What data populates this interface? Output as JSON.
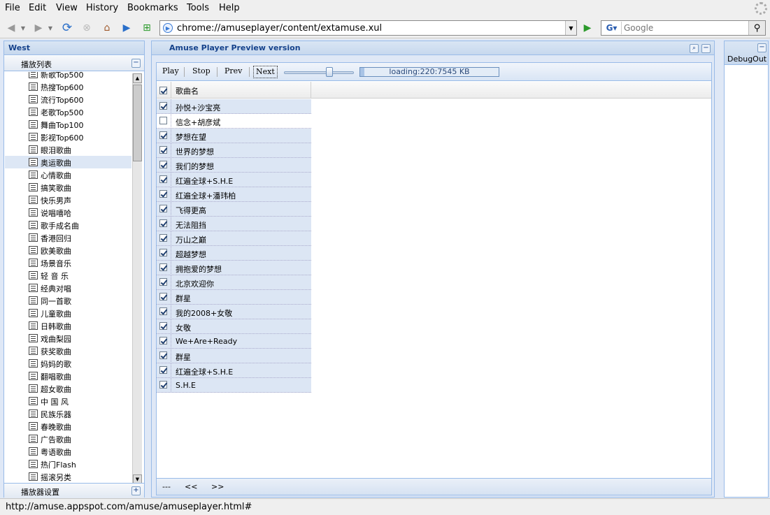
{
  "menu": [
    "File",
    "Edit",
    "View",
    "History",
    "Bookmarks",
    "Tools",
    "Help"
  ],
  "nav": {
    "url": "chrome://amuseplayer/content/extamuse.xul",
    "search_placeholder": "Google"
  },
  "west": {
    "title": "West",
    "playlist_header": "播放列表",
    "settings_header": "播放器设置",
    "items": [
      "新歌Top500",
      "热搜Top600",
      "流行Top600",
      "老歌Top500",
      "舞曲Top100",
      "影视Top600",
      "眼泪歌曲",
      "奥运歌曲",
      "心情歌曲",
      "搞笑歌曲",
      "快乐男声",
      "说唱嘻哈",
      "歌手成名曲",
      "香港回归",
      "欧美歌曲",
      "场景音乐",
      "轻 音 乐",
      "经典对唱",
      "同一首歌",
      "儿童歌曲",
      "日韩歌曲",
      "戏曲梨园",
      "获奖歌曲",
      "妈妈的歌",
      "翻唱歌曲",
      "超女歌曲",
      "中 国 风",
      "民族乐器",
      "春晚歌曲",
      "广告歌曲",
      "粤语歌曲",
      "热门Flash",
      "摇滚另类"
    ],
    "selected_index": 7
  },
  "center": {
    "title": "Amuse Player Preview version",
    "toolbar": {
      "play": "Play",
      "stop": "Stop",
      "prev": "Prev",
      "next": "Next"
    },
    "volume": 0.65,
    "loading": {
      "text": "loading:220:7545 KB",
      "percent": 2.9
    },
    "grid_header": "歌曲名",
    "songs": [
      {
        "name": "孙悦+沙宝亮",
        "checked": true
      },
      {
        "name": "信念+胡彦斌",
        "checked": false
      },
      {
        "name": "梦想在望",
        "checked": true
      },
      {
        "name": "世界的梦想",
        "checked": true
      },
      {
        "name": "我们的梦想",
        "checked": true
      },
      {
        "name": "红遍全球+S.H.E",
        "checked": true
      },
      {
        "name": "红遍全球+潘玮柏",
        "checked": true
      },
      {
        "name": "飞得更高",
        "checked": true
      },
      {
        "name": "无法阻挡",
        "checked": true
      },
      {
        "name": "万山之巅",
        "checked": true
      },
      {
        "name": "超越梦想",
        "checked": true
      },
      {
        "name": "拥抱爱的梦想",
        "checked": true
      },
      {
        "name": "北京欢迎你",
        "checked": true
      },
      {
        "name": "群星",
        "checked": true
      },
      {
        "name": "我的2008+女敬",
        "checked": true
      },
      {
        "name": "女敬",
        "checked": true
      },
      {
        "name": "We+Are+Ready",
        "checked": true
      },
      {
        "name": "群星",
        "checked": true
      },
      {
        "name": "红遍全球+S.H.E",
        "checked": true
      },
      {
        "name": "S.H.E",
        "checked": true
      }
    ],
    "pager": {
      "dashes": "---",
      "first": "<<",
      "last": ">>"
    }
  },
  "east": {
    "title": "DebugOut"
  },
  "status": "http://amuse.appspot.com/amuse/amuseplayer.html#"
}
